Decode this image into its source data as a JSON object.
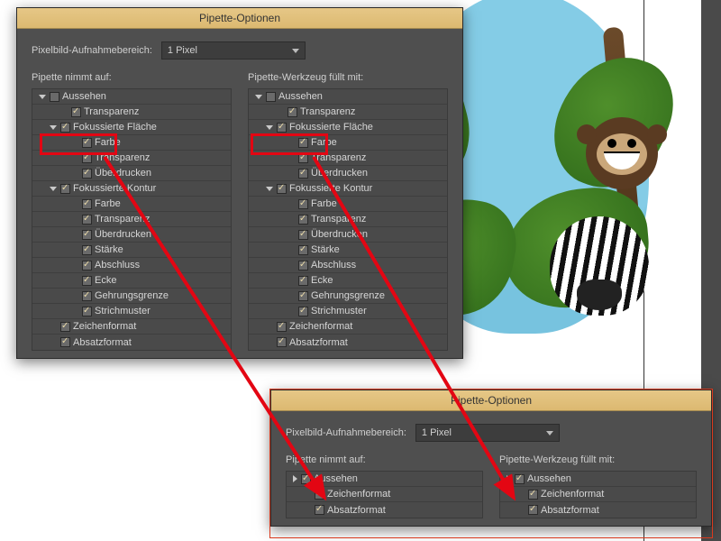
{
  "dialog": {
    "title": "Pipette-Optionen",
    "raster_label": "Pixelbild-Aufnahmebereich:",
    "raster_value": "1 Pixel",
    "col_left_header": "Pipette nimmt auf:",
    "col_right_header": "Pipette-Werkzeug füllt mit:"
  },
  "tree_main": [
    {
      "caret": "down",
      "indent": 0,
      "checked": false,
      "label": "Aussehen"
    },
    {
      "caret": "none",
      "indent": 2,
      "checked": true,
      "label": "Transparenz"
    },
    {
      "caret": "down",
      "indent": 1,
      "checked": true,
      "label": "Fokussierte Fläche"
    },
    {
      "caret": "none",
      "indent": 3,
      "checked": true,
      "label": "Farbe"
    },
    {
      "caret": "none",
      "indent": 3,
      "checked": true,
      "label": "Transparenz"
    },
    {
      "caret": "none",
      "indent": 3,
      "checked": true,
      "label": "Überdrucken"
    },
    {
      "caret": "down",
      "indent": 1,
      "checked": true,
      "label": "Fokussierte Kontur"
    },
    {
      "caret": "none",
      "indent": 3,
      "checked": true,
      "label": "Farbe"
    },
    {
      "caret": "none",
      "indent": 3,
      "checked": true,
      "label": "Transparenz"
    },
    {
      "caret": "none",
      "indent": 3,
      "checked": true,
      "label": "Überdrucken"
    },
    {
      "caret": "none",
      "indent": 3,
      "checked": true,
      "label": "Stärke"
    },
    {
      "caret": "none",
      "indent": 3,
      "checked": true,
      "label": "Abschluss"
    },
    {
      "caret": "none",
      "indent": 3,
      "checked": true,
      "label": "Ecke"
    },
    {
      "caret": "none",
      "indent": 3,
      "checked": true,
      "label": "Gehrungsgrenze"
    },
    {
      "caret": "none",
      "indent": 3,
      "checked": true,
      "label": "Strichmuster"
    },
    {
      "caret": "none",
      "indent": 1,
      "checked": true,
      "label": "Zeichenformat"
    },
    {
      "caret": "none",
      "indent": 1,
      "checked": true,
      "label": "Absatzformat"
    }
  ],
  "tree_small": [
    {
      "caret": "right",
      "indent": 0,
      "checked": true,
      "label": "Aussehen"
    },
    {
      "caret": "none",
      "indent": 1,
      "checked": true,
      "label": "Zeichenformat"
    },
    {
      "caret": "none",
      "indent": 1,
      "checked": true,
      "label": "Absatzformat"
    }
  ]
}
